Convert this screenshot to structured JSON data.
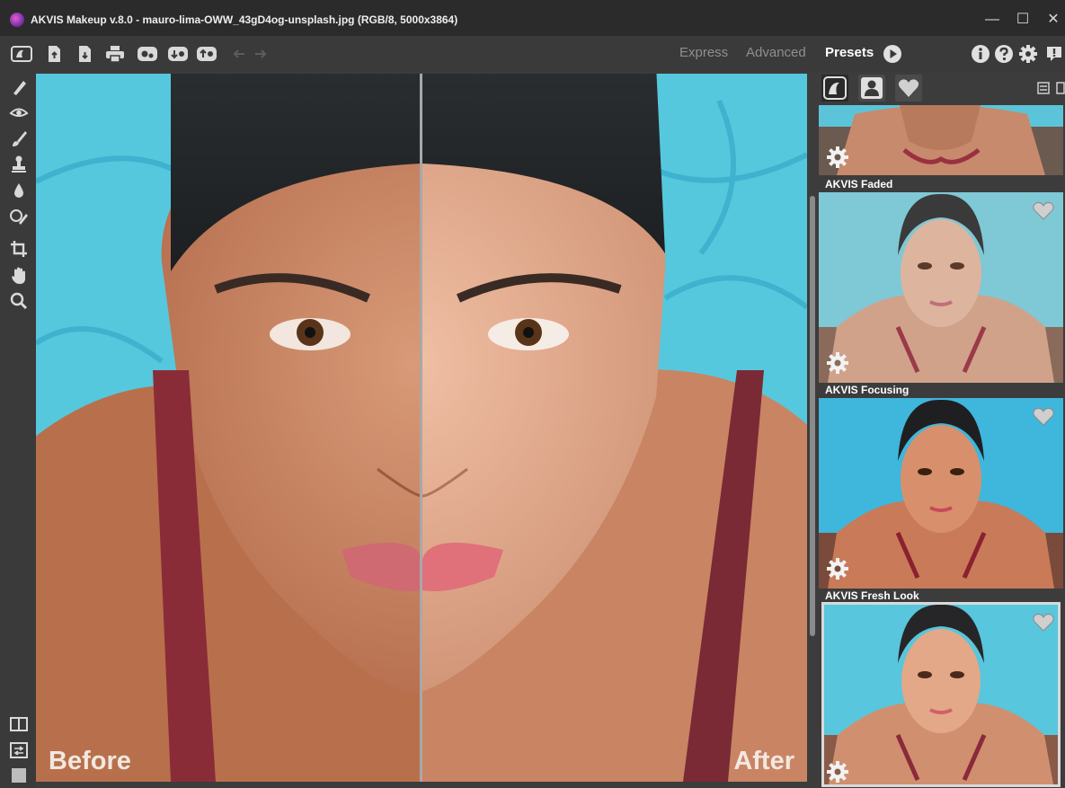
{
  "window": {
    "title": "AKVIS Makeup v.8.0 - mauro-lima-OWW_43gD4og-unsplash.jpg (RGB/8, 5000x3864)",
    "minimize": "—",
    "maximize": "☐",
    "close": "✕"
  },
  "toolbar": {
    "left_icons": [
      "about-program-icon",
      "open-file-icon",
      "save-file-icon",
      "print-icon",
      "batch-processing-icon",
      "load-preset-icon",
      "save-preset-icon",
      "undo-icon",
      "redo-icon"
    ],
    "modes": {
      "express": "Express",
      "advanced": "Advanced"
    },
    "presets": "Presets",
    "right_icons": [
      "info-icon",
      "help-icon",
      "settings-icon",
      "feedback-icon"
    ]
  },
  "tools": [
    "retouch-brush-icon",
    "eye-icon",
    "brush-icon",
    "stamp-icon",
    "drop-icon",
    "eraser-icon",
    "crop-icon",
    "hand-icon",
    "zoom-icon",
    "view-split-icon",
    "view-switch-icon",
    "background-color-icon"
  ],
  "canvas": {
    "before": "Before",
    "after": "After"
  },
  "panel": {
    "tabs": [
      "akvis-presets-tab",
      "user-presets-tab",
      "favorites-tab"
    ],
    "presets": [
      {
        "name": "AKVIS Faded"
      },
      {
        "name": "AKVIS Focusing"
      },
      {
        "name": "AKVIS Fresh Look"
      }
    ]
  },
  "colors": {
    "accent": "#ffffff",
    "pool": "#4ec7de",
    "skin": "#c77b55",
    "panel": "#3c3c3c"
  }
}
